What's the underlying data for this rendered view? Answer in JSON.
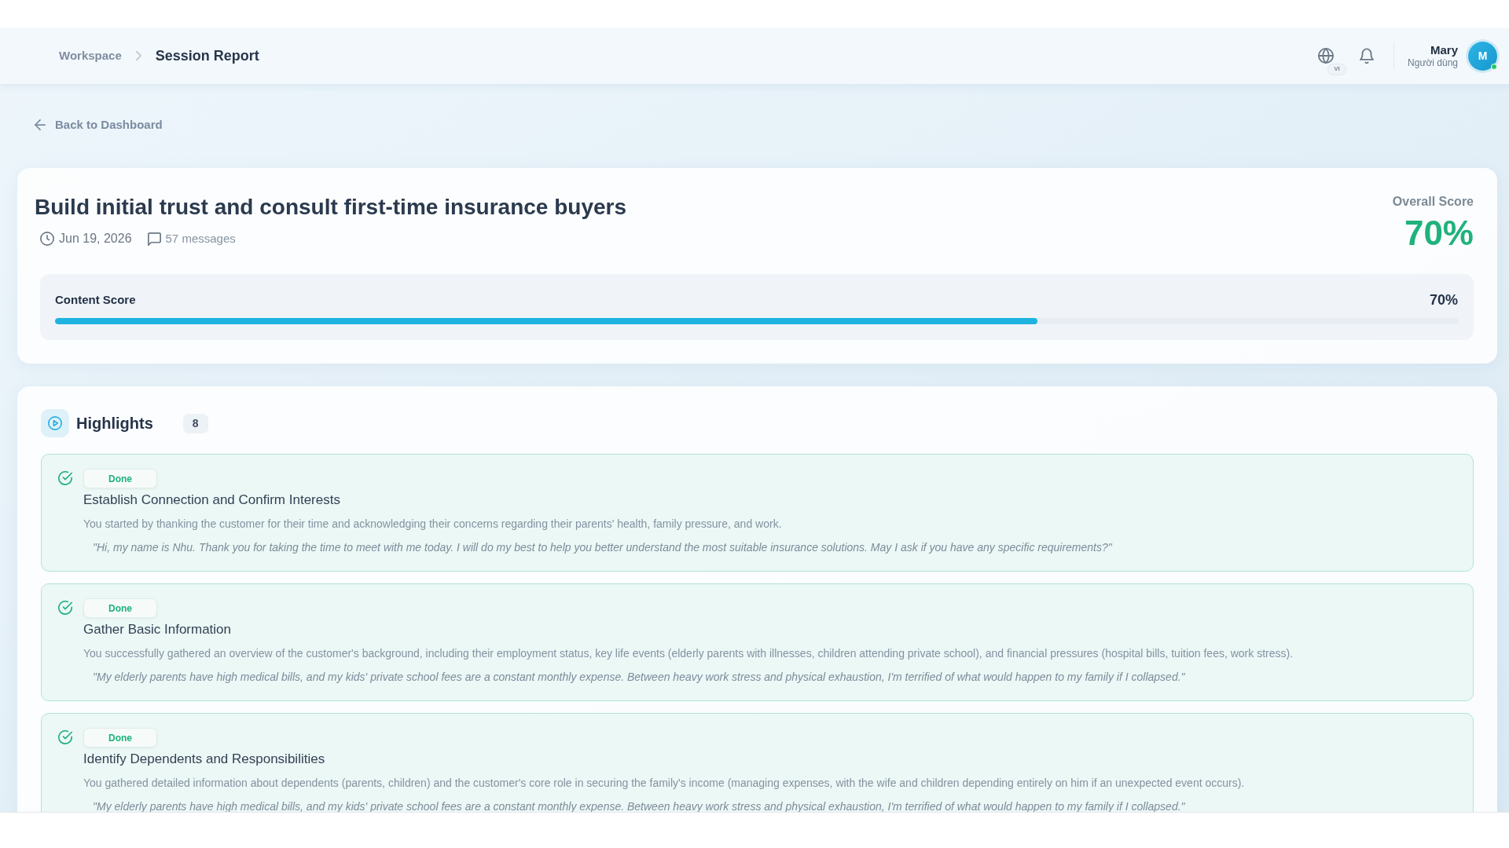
{
  "header": {
    "breadcrumbs": [
      {
        "label": "Workspace",
        "current": false
      },
      {
        "label": "Session Report",
        "current": true
      }
    ],
    "language": "VI",
    "user": {
      "name": "Mary",
      "role": "Người dùng",
      "initial": "M",
      "online": true
    }
  },
  "back_link": "Back to Dashboard",
  "session": {
    "title": "Build initial trust and consult first-time insurance buyers",
    "date": "Jun 19, 2026",
    "messages": "57 messages",
    "overall_score": {
      "label": "Overall Score",
      "value": "70%"
    },
    "content_score": {
      "label": "Content Score",
      "value": "70%",
      "level": 0.7
    }
  },
  "highlights": {
    "title": "Highlights",
    "count": "8",
    "items": [
      {
        "status": "Done",
        "completed": true,
        "title": "Establish Connection and Confirm Interests",
        "description": "You started by thanking the customer for their time and acknowledging their concerns regarding their parents' health, family pressure, and work.",
        "quote": "\"Hi, my name is Nhu. Thank you for taking the time to meet with me today. I will do my best to help you better understand the most suitable insurance solutions. May I ask if you have any specific requirements?\""
      },
      {
        "status": "Done",
        "completed": true,
        "title": "Gather Basic Information",
        "description": "You successfully gathered an overview of the customer's background, including their employment status, key life events (elderly parents with illnesses, children attending private school), and financial pressures (hospital bills, tuition fees, work stress).",
        "quote": "\"My elderly parents have high medical bills, and my kids' private school fees are a constant monthly expense. Between heavy work stress and physical exhaustion, I'm terrified of what would happen to my family if I collapsed.\""
      },
      {
        "status": "Done",
        "completed": true,
        "title": "Identify Dependents and Responsibilities",
        "description": "You gathered detailed information about dependents (parents, children) and the customer's core role in securing the family's income (managing expenses, with the wife and children depending entirely on him if an unexpected event occurs).",
        "quote": "\"My elderly parents have high medical bills, and my kids' private school fees are a constant monthly expense. Between heavy work stress and physical exhaustion, I'm terrified of what would happen to my family if I collapsed.\""
      }
    ]
  }
}
